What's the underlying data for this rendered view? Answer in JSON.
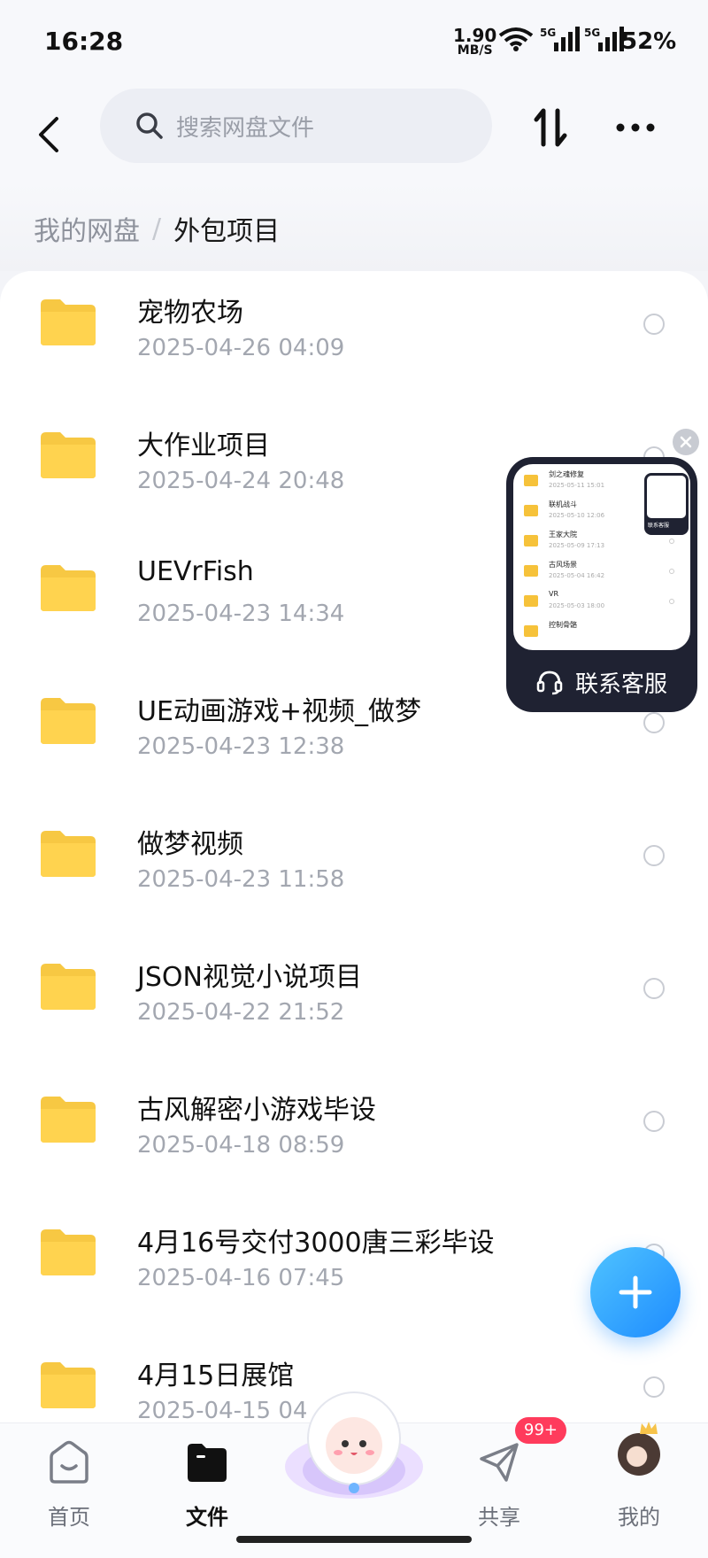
{
  "status_bar": {
    "time": "16:28",
    "net_speed_value": "1.90",
    "net_speed_unit": "MB/S",
    "sim1_label": "5G",
    "sim2_label": "5G",
    "battery": "52%"
  },
  "header": {
    "search_placeholder": "搜索网盘文件",
    "icons": [
      "back-arrow-icon",
      "search-icon",
      "sort-icon",
      "more-icon"
    ]
  },
  "breadcrumb": {
    "root": "我的网盘",
    "separator": "/",
    "current": "外包项目"
  },
  "files": [
    {
      "name": "宠物农场",
      "date": "2025-04-26  04:09"
    },
    {
      "name": "大作业项目",
      "date": "2025-04-24  20:48"
    },
    {
      "name": "UEVrFish",
      "date": "2025-04-23  14:34"
    },
    {
      "name": "UE动画游戏+视频_做梦",
      "date": "2025-04-23  12:38"
    },
    {
      "name": "做梦视频",
      "date": "2025-04-23  11:58"
    },
    {
      "name": "JSON视觉小说项目",
      "date": "2025-04-22  21:52"
    },
    {
      "name": "古风解密小游戏毕设",
      "date": "2025-04-18  08:59"
    },
    {
      "name": "4月16号交付3000唐三彩毕设",
      "date": "2025-04-16  07:45"
    },
    {
      "name": "4月15日展馆",
      "date": "2025-04-15  04"
    }
  ],
  "pip_window": {
    "items": [
      {
        "name": "剑之魂修复",
        "date": "2025-05-11 15:01"
      },
      {
        "name": "联机战斗",
        "date": "2025-05-10 12:06"
      },
      {
        "name": "王家大院",
        "date": "2025-05-09 17:13"
      },
      {
        "name": "古风场景",
        "date": "2025-05-04 16:42"
      },
      {
        "name": "VR",
        "date": "2025-05-03 18:00"
      },
      {
        "name": "控制骨骼",
        "date": ""
      }
    ],
    "mini_label": "联系客服",
    "footer_label": "联系客服"
  },
  "tabbar": {
    "tabs": [
      {
        "label": "首页"
      },
      {
        "label": "文件"
      },
      {
        "label": "共享"
      },
      {
        "label": "我的"
      }
    ],
    "active_tab": "文件",
    "share_badge": "99+"
  },
  "colors": {
    "folder": "#F7C843",
    "accent": "#1E8CFF",
    "badge": "#FF3B5C"
  }
}
